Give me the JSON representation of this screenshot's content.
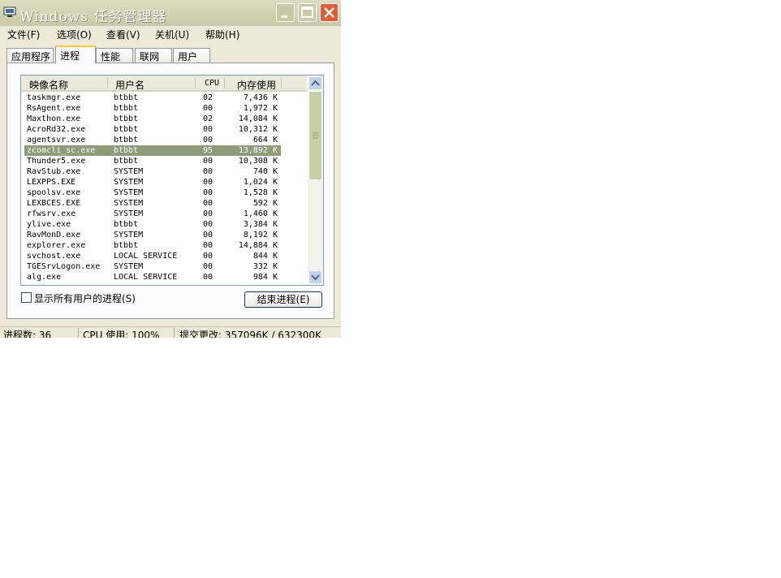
{
  "window": {
    "title": "Windows 任务管理器",
    "icon": "task-manager-icon",
    "colors": {
      "close": "#e35a35",
      "selection": "#8f9c7a",
      "tab_highlight": "#ffc83c"
    }
  },
  "menu": [
    {
      "label": "文件(F)"
    },
    {
      "label": "选项(O)"
    },
    {
      "label": "查看(V)"
    },
    {
      "label": "关机(U)"
    },
    {
      "label": "帮助(H)"
    }
  ],
  "tabs": [
    {
      "label": "应用程序",
      "active": false
    },
    {
      "label": "进程",
      "active": true
    },
    {
      "label": "性能",
      "active": false
    },
    {
      "label": "联网",
      "active": false
    },
    {
      "label": "用户",
      "active": false
    }
  ],
  "process_list": {
    "columns": [
      "映像名称",
      "用户名",
      "CPU",
      "内存使用"
    ],
    "rows": [
      {
        "name": "taskmgr.exe",
        "user": "btbbt",
        "cpu": "02",
        "mem": "7,436 K"
      },
      {
        "name": "RsAgent.exe",
        "user": "btbbt",
        "cpu": "00",
        "mem": "1,972 K"
      },
      {
        "name": "Maxthon.exe",
        "user": "btbbt",
        "cpu": "02",
        "mem": "14,084 K"
      },
      {
        "name": "AcroRd32.exe",
        "user": "btbbt",
        "cpu": "00",
        "mem": "10,312 K"
      },
      {
        "name": "agentsvr.exe",
        "user": "btbbt",
        "cpu": "00",
        "mem": "664 K"
      },
      {
        "name": "zcomcli_sc.exe",
        "user": "btbbt",
        "cpu": "95",
        "mem": "13,892 K",
        "selected": true
      },
      {
        "name": "Thunder5.exe",
        "user": "btbbt",
        "cpu": "00",
        "mem": "10,308 K"
      },
      {
        "name": "RavStub.exe",
        "user": "SYSTEM",
        "cpu": "00",
        "mem": "740 K"
      },
      {
        "name": "LEXPPS.EXE",
        "user": "SYSTEM",
        "cpu": "00",
        "mem": "1,024 K"
      },
      {
        "name": "spoolsv.exe",
        "user": "SYSTEM",
        "cpu": "00",
        "mem": "1,528 K"
      },
      {
        "name": "LEXBCES.EXE",
        "user": "SYSTEM",
        "cpu": "00",
        "mem": "592 K"
      },
      {
        "name": "rfwsrv.exe",
        "user": "SYSTEM",
        "cpu": "00",
        "mem": "1,460 K"
      },
      {
        "name": "ylive.exe",
        "user": "btbbt",
        "cpu": "00",
        "mem": "3,384 K"
      },
      {
        "name": "RavMonD.exe",
        "user": "SYSTEM",
        "cpu": "00",
        "mem": "8,192 K"
      },
      {
        "name": "explorer.exe",
        "user": "btbbt",
        "cpu": "00",
        "mem": "14,884 K"
      },
      {
        "name": "svchost.exe",
        "user": "LOCAL SERVICE",
        "cpu": "00",
        "mem": "844 K"
      },
      {
        "name": "TGESrvLogon.exe",
        "user": "SYSTEM",
        "cpu": "00",
        "mem": "332 K"
      },
      {
        "name": "alg.exe",
        "user": "LOCAL SERVICE",
        "cpu": "00",
        "mem": "984 K"
      }
    ]
  },
  "show_all_users": {
    "label": "显示所有用户的进程(S)",
    "checked": false
  },
  "end_process": {
    "label": "结束进程(E)"
  },
  "status": {
    "processes": "进程数: 36",
    "cpu": "CPU 使用: 100%",
    "commit": "提交更改: 357096K / 632300K"
  }
}
